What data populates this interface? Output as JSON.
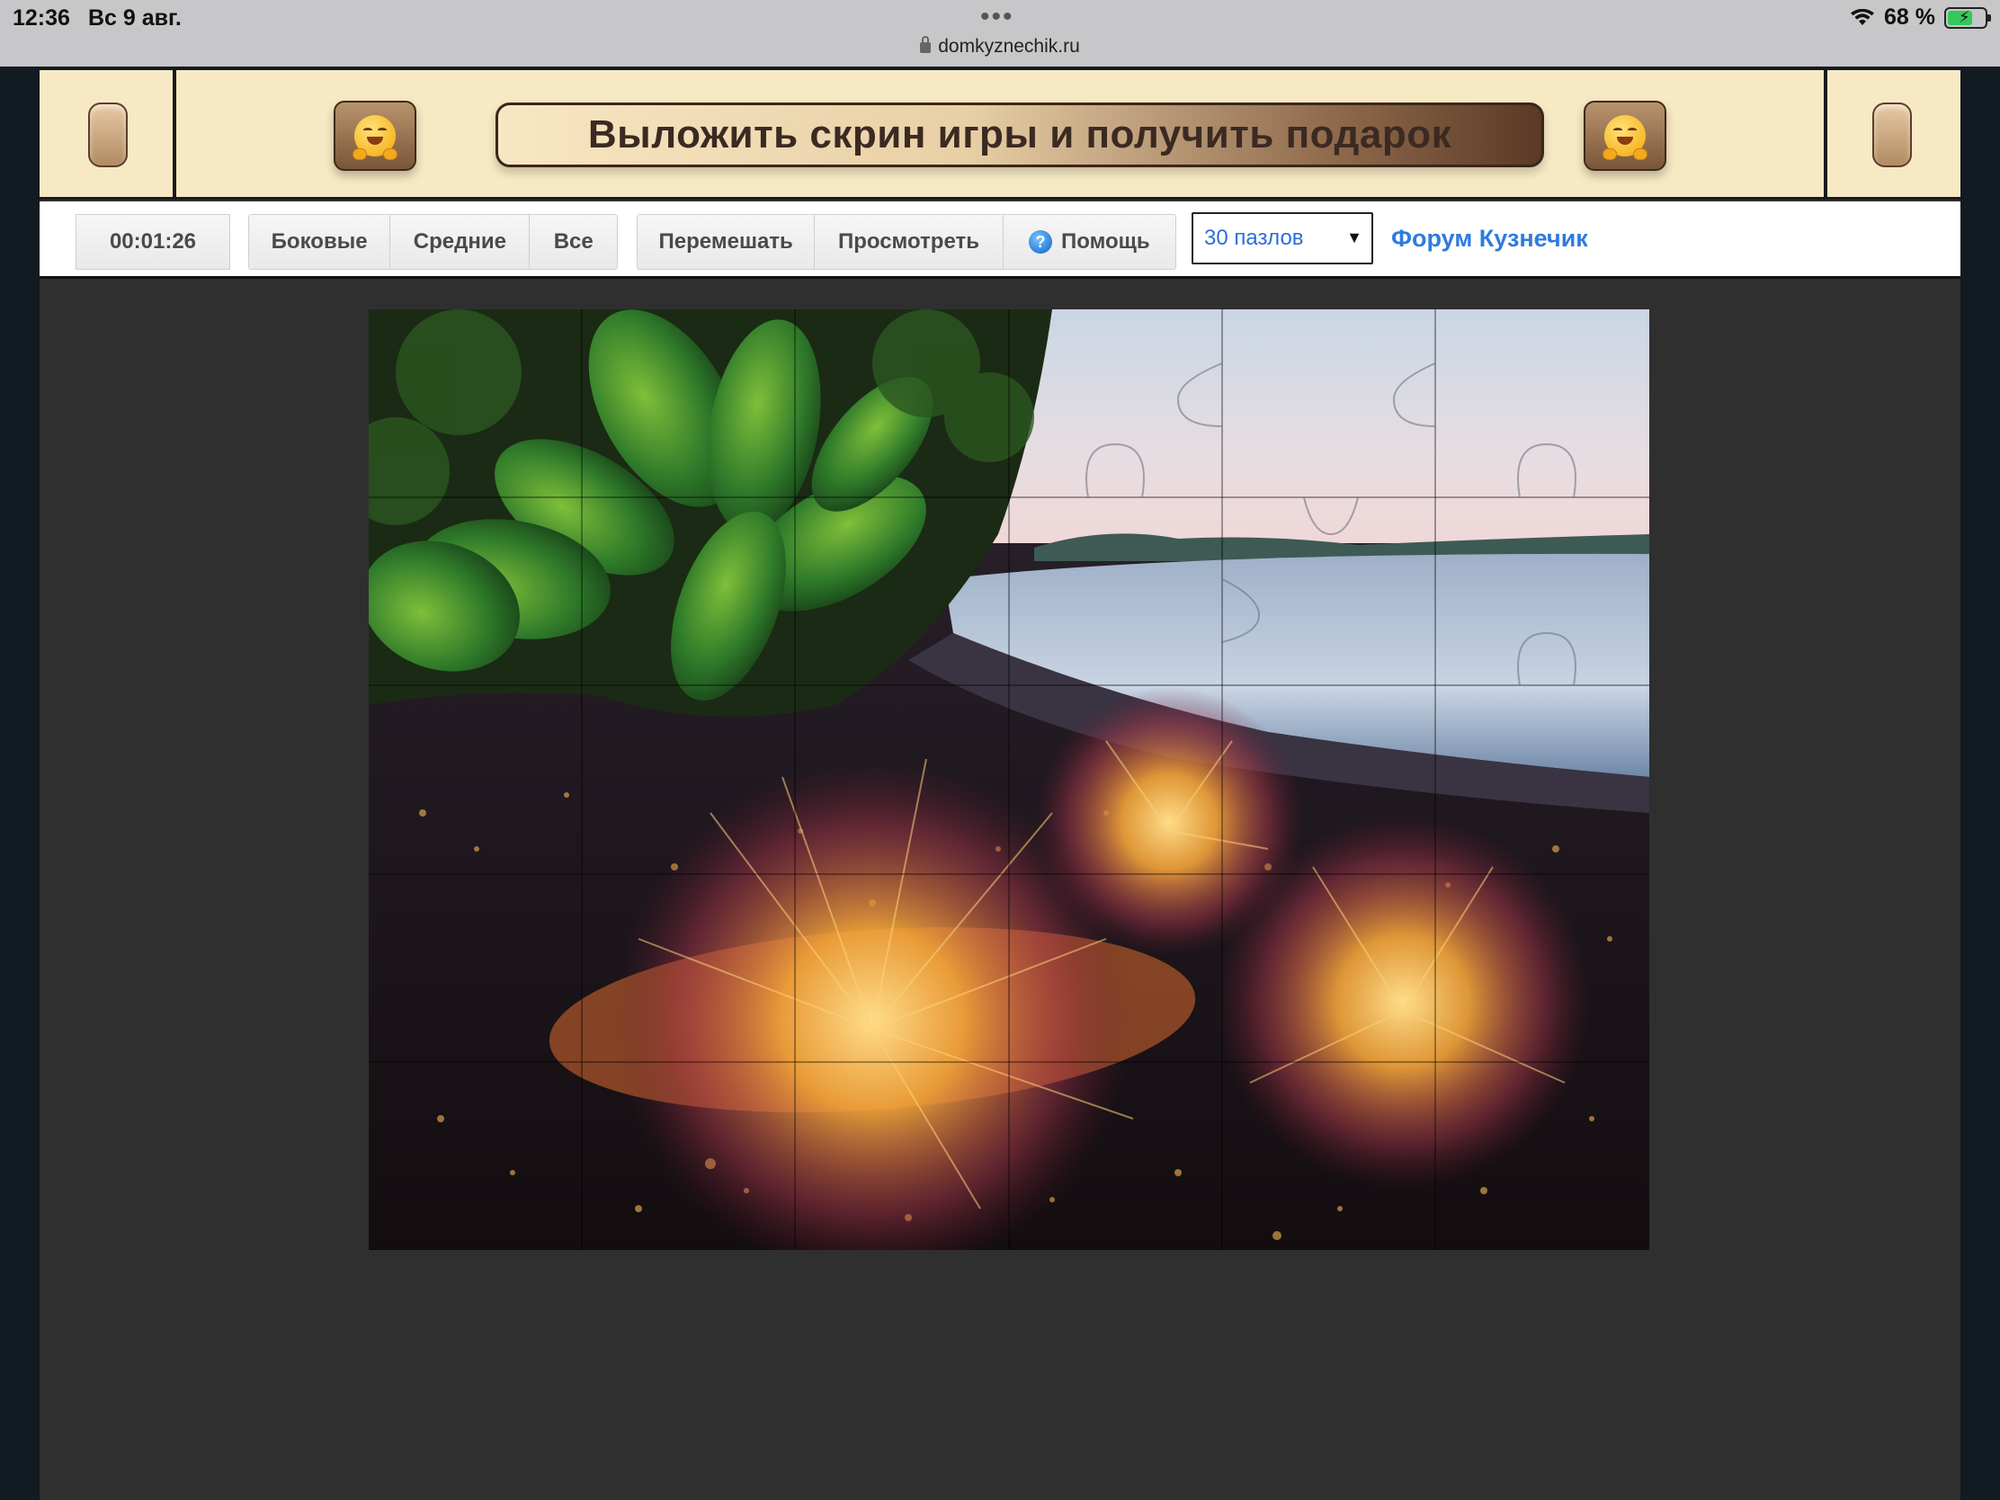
{
  "status_bar": {
    "time": "12:36",
    "date": "Вс 9 авг.",
    "url": "domkyznechik.ru",
    "battery": "68 %"
  },
  "banner": {
    "headline": "Выложить скрин игры и получить подарок",
    "left_icon": "hugging-face-emoji",
    "right_icon": "hugging-face-emoji"
  },
  "toolbar": {
    "timer": "00:01:26",
    "filter_group": [
      "Боковые",
      "Средние",
      "Все"
    ],
    "shuffle_label": "Перемешать",
    "preview_label": "Просмотреть",
    "help_label": "Помощь",
    "pieces_select": "30 пазлов",
    "forum_link": "Форум Кузнечик"
  },
  "puzzle": {
    "pieces_total": 30,
    "grid_columns": 6,
    "grid_rows": 5
  },
  "colors": {
    "banner_bg": "#f7e9c3",
    "page_bg": "#2f2f2f",
    "link": "#2f7be0"
  }
}
